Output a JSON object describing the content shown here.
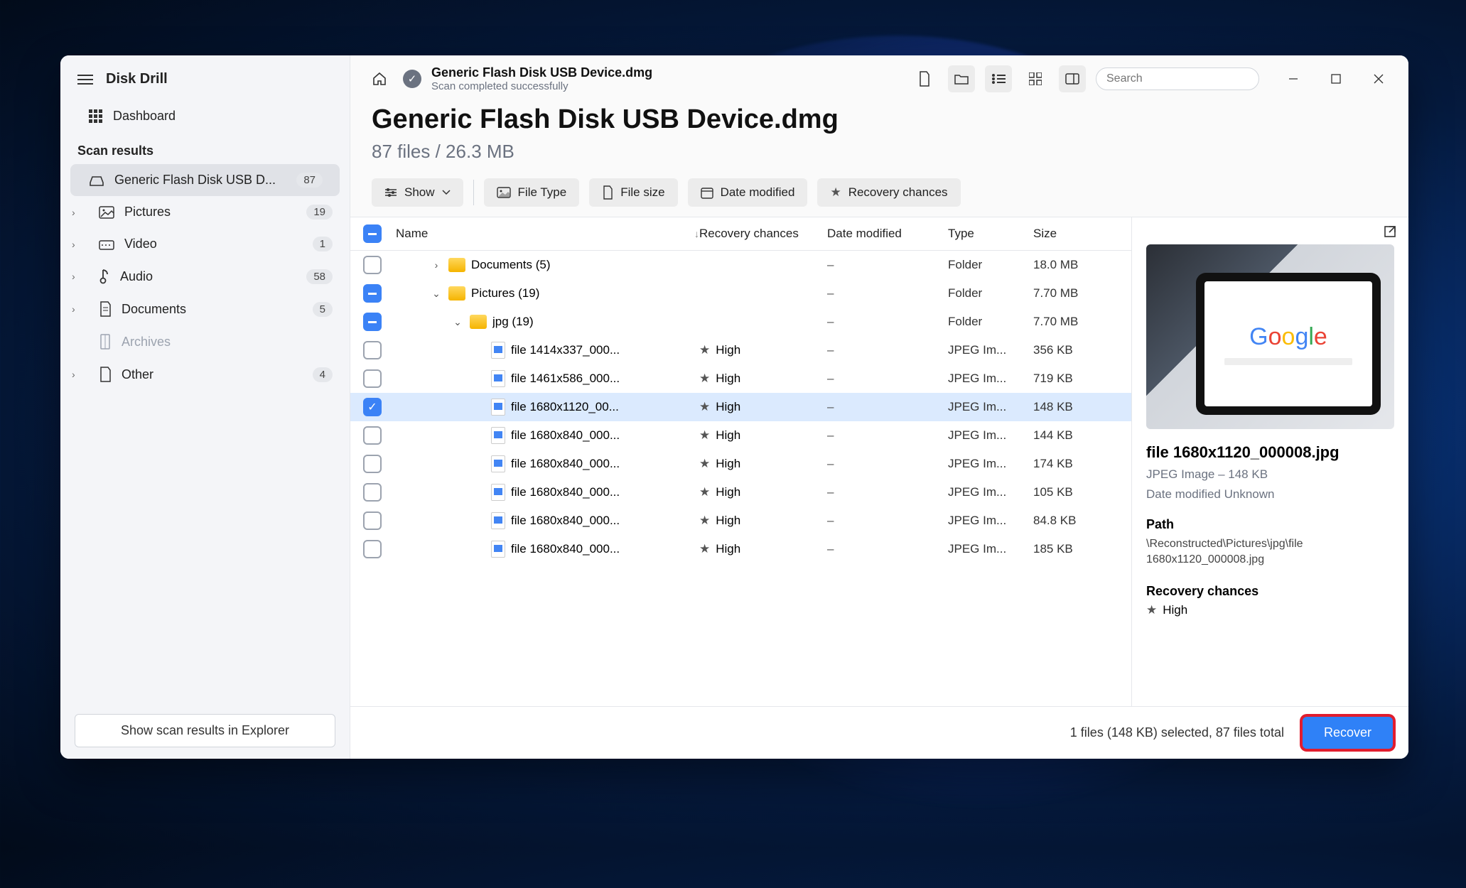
{
  "app_title": "Disk Drill",
  "sidebar": {
    "dashboard": "Dashboard",
    "section": "Scan results",
    "device": {
      "label": "Generic Flash Disk USB D...",
      "count": "87"
    },
    "items": [
      {
        "label": "Pictures",
        "count": "19"
      },
      {
        "label": "Video",
        "count": "1"
      },
      {
        "label": "Audio",
        "count": "58"
      },
      {
        "label": "Documents",
        "count": "5"
      },
      {
        "label": "Archives",
        "count": ""
      },
      {
        "label": "Other",
        "count": "4"
      }
    ],
    "explorer_btn": "Show scan results in Explorer"
  },
  "topbar": {
    "title": "Generic Flash Disk USB Device.dmg",
    "subtitle": "Scan completed successfully",
    "search_placeholder": "Search"
  },
  "heading": {
    "title": "Generic Flash Disk USB Device.dmg",
    "subtitle": "87 files / 26.3 MB"
  },
  "chips": {
    "show": "Show",
    "filetype": "File Type",
    "filesize": "File size",
    "datemod": "Date modified",
    "recchance": "Recovery chances"
  },
  "columns": {
    "name": "Name",
    "rec": "Recovery chances",
    "date": "Date modified",
    "type": "Type",
    "size": "Size"
  },
  "rows": [
    {
      "chk": "none",
      "level": 1,
      "arrow": "right",
      "icon": "folder",
      "name": "Documents (5)",
      "rec": "",
      "date": "–",
      "type": "Folder",
      "size": "18.0 MB"
    },
    {
      "chk": "minus",
      "level": 1,
      "arrow": "down",
      "icon": "folder",
      "name": "Pictures (19)",
      "rec": "",
      "date": "–",
      "type": "Folder",
      "size": "7.70 MB"
    },
    {
      "chk": "minus",
      "level": 2,
      "arrow": "down",
      "icon": "folder",
      "name": "jpg (19)",
      "rec": "",
      "date": "–",
      "type": "Folder",
      "size": "7.70 MB"
    },
    {
      "chk": "none",
      "level": 3,
      "arrow": "",
      "icon": "file",
      "name": "file 1414x337_000...",
      "rec": "High",
      "date": "–",
      "type": "JPEG Im...",
      "size": "356 KB"
    },
    {
      "chk": "none",
      "level": 3,
      "arrow": "",
      "icon": "file",
      "name": "file 1461x586_000...",
      "rec": "High",
      "date": "–",
      "type": "JPEG Im...",
      "size": "719 KB"
    },
    {
      "chk": "check",
      "level": 3,
      "arrow": "",
      "icon": "file",
      "name": "file 1680x1120_00...",
      "rec": "High",
      "date": "–",
      "type": "JPEG Im...",
      "size": "148 KB",
      "sel": true
    },
    {
      "chk": "none",
      "level": 3,
      "arrow": "",
      "icon": "file",
      "name": "file 1680x840_000...",
      "rec": "High",
      "date": "–",
      "type": "JPEG Im...",
      "size": "144 KB"
    },
    {
      "chk": "none",
      "level": 3,
      "arrow": "",
      "icon": "file",
      "name": "file 1680x840_000...",
      "rec": "High",
      "date": "–",
      "type": "JPEG Im...",
      "size": "174 KB"
    },
    {
      "chk": "none",
      "level": 3,
      "arrow": "",
      "icon": "file",
      "name": "file 1680x840_000...",
      "rec": "High",
      "date": "–",
      "type": "JPEG Im...",
      "size": "105 KB"
    },
    {
      "chk": "none",
      "level": 3,
      "arrow": "",
      "icon": "file",
      "name": "file 1680x840_000...",
      "rec": "High",
      "date": "–",
      "type": "JPEG Im...",
      "size": "84.8 KB"
    },
    {
      "chk": "none",
      "level": 3,
      "arrow": "",
      "icon": "file",
      "name": "file 1680x840_000...",
      "rec": "High",
      "date": "–",
      "type": "JPEG Im...",
      "size": "185 KB"
    }
  ],
  "details": {
    "filename": "file 1680x1120_000008.jpg",
    "meta": "JPEG Image – 148 KB",
    "date": "Date modified Unknown",
    "path_label": "Path",
    "path": "\\Reconstructed\\Pictures\\jpg\\file 1680x1120_000008.jpg",
    "rec_label": "Recovery chances",
    "rec_value": "High"
  },
  "footer": {
    "status": "1 files (148 KB) selected, 87 files total",
    "recover": "Recover"
  }
}
